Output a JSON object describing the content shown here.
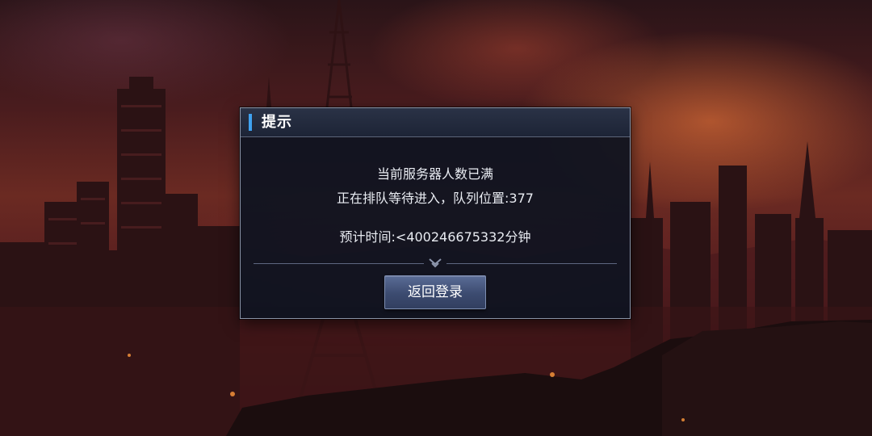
{
  "dialog": {
    "title": "提示",
    "message_line_1": "当前服务器人数已满",
    "message_line_2": "正在排队等待进入，队列位置:377",
    "message_line_3": "预计时间:<400246675332分钟",
    "button_label": "返回登录"
  },
  "colors": {
    "dialog_background": "#0e1320",
    "title_accent": "#3fa2f0",
    "button_fill": "#3c4b70",
    "sky": "#6b2a22"
  },
  "icons": {
    "divider": "chevron-down-icon"
  }
}
